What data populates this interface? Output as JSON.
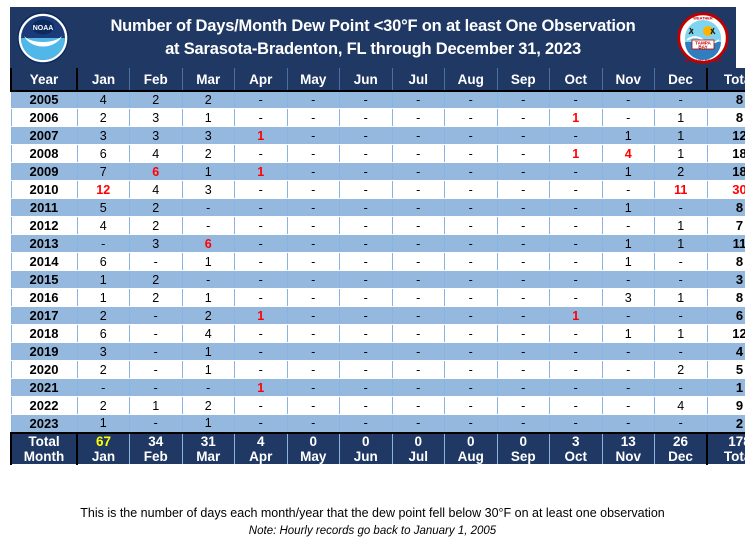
{
  "banner": {
    "title_line1": "Number of Days/Month Dew Point <30°F on at least One Observation",
    "title_line2": "at Sarasota-Bradenton, FL through December 31, 2023",
    "left_logo": "noaa-logo",
    "right_logo": "nws-tampa-bay-logo",
    "bg_color": "#1f3864"
  },
  "colors": {
    "header_bg": "#1f3864",
    "row_odd": "#95b8df",
    "row_even": "#ffffff",
    "highlight": "#ff0000",
    "total_highlight": "#ffff00",
    "grid_line": "#8ab3e0"
  },
  "table": {
    "columns": [
      "Year",
      "Jan",
      "Feb",
      "Mar",
      "Apr",
      "May",
      "Jun",
      "Jul",
      "Aug",
      "Sep",
      "Oct",
      "Nov",
      "Dec",
      "Total"
    ],
    "rows": [
      {
        "year": "2005",
        "values": [
          "4",
          "2",
          "2",
          "-",
          "-",
          "-",
          "-",
          "-",
          "-",
          "-",
          "-",
          "-"
        ],
        "hi": [],
        "total": "8",
        "total_hi": false
      },
      {
        "year": "2006",
        "values": [
          "2",
          "3",
          "1",
          "-",
          "-",
          "-",
          "-",
          "-",
          "-",
          "1",
          "-",
          "1"
        ],
        "hi": [
          9
        ],
        "total": "8",
        "total_hi": false
      },
      {
        "year": "2007",
        "values": [
          "3",
          "3",
          "3",
          "1",
          "-",
          "-",
          "-",
          "-",
          "-",
          "-",
          "1",
          "1"
        ],
        "hi": [
          3
        ],
        "total": "12",
        "total_hi": false
      },
      {
        "year": "2008",
        "values": [
          "6",
          "4",
          "2",
          "-",
          "-",
          "-",
          "-",
          "-",
          "-",
          "1",
          "4",
          "1"
        ],
        "hi": [
          9,
          10
        ],
        "total": "18",
        "total_hi": false
      },
      {
        "year": "2009",
        "values": [
          "7",
          "6",
          "1",
          "1",
          "-",
          "-",
          "-",
          "-",
          "-",
          "-",
          "1",
          "2"
        ],
        "hi": [
          1,
          3
        ],
        "total": "18",
        "total_hi": false
      },
      {
        "year": "2010",
        "values": [
          "12",
          "4",
          "3",
          "-",
          "-",
          "-",
          "-",
          "-",
          "-",
          "-",
          "-",
          "11"
        ],
        "hi": [
          0,
          11
        ],
        "total": "30",
        "total_hi": true
      },
      {
        "year": "2011",
        "values": [
          "5",
          "2",
          "-",
          "-",
          "-",
          "-",
          "-",
          "-",
          "-",
          "-",
          "1",
          "-"
        ],
        "hi": [],
        "total": "8",
        "total_hi": false
      },
      {
        "year": "2012",
        "values": [
          "4",
          "2",
          "-",
          "-",
          "-",
          "-",
          "-",
          "-",
          "-",
          "-",
          "-",
          "1"
        ],
        "hi": [],
        "total": "7",
        "total_hi": false
      },
      {
        "year": "2013",
        "values": [
          "-",
          "3",
          "6",
          "-",
          "-",
          "-",
          "-",
          "-",
          "-",
          "-",
          "1",
          "1"
        ],
        "hi": [
          2
        ],
        "total": "11",
        "total_hi": false
      },
      {
        "year": "2014",
        "values": [
          "6",
          "-",
          "1",
          "-",
          "-",
          "-",
          "-",
          "-",
          "-",
          "-",
          "1",
          "-"
        ],
        "hi": [],
        "total": "8",
        "total_hi": false
      },
      {
        "year": "2015",
        "values": [
          "1",
          "2",
          "-",
          "-",
          "-",
          "-",
          "-",
          "-",
          "-",
          "-",
          "-",
          "-"
        ],
        "hi": [],
        "total": "3",
        "total_hi": false
      },
      {
        "year": "2016",
        "values": [
          "1",
          "2",
          "1",
          "-",
          "-",
          "-",
          "-",
          "-",
          "-",
          "-",
          "3",
          "1"
        ],
        "hi": [],
        "total": "8",
        "total_hi": false
      },
      {
        "year": "2017",
        "values": [
          "2",
          "-",
          "2",
          "1",
          "-",
          "-",
          "-",
          "-",
          "-",
          "1",
          "-",
          "-"
        ],
        "hi": [
          3,
          9
        ],
        "total": "6",
        "total_hi": false
      },
      {
        "year": "2018",
        "values": [
          "6",
          "-",
          "4",
          "-",
          "-",
          "-",
          "-",
          "-",
          "-",
          "-",
          "1",
          "1"
        ],
        "hi": [],
        "total": "12",
        "total_hi": false
      },
      {
        "year": "2019",
        "values": [
          "3",
          "-",
          "1",
          "-",
          "-",
          "-",
          "-",
          "-",
          "-",
          "-",
          "-",
          "-"
        ],
        "hi": [],
        "total": "4",
        "total_hi": false
      },
      {
        "year": "2020",
        "values": [
          "2",
          "-",
          "1",
          "-",
          "-",
          "-",
          "-",
          "-",
          "-",
          "-",
          "-",
          "2"
        ],
        "hi": [],
        "total": "5",
        "total_hi": false
      },
      {
        "year": "2021",
        "values": [
          "-",
          "-",
          "-",
          "1",
          "-",
          "-",
          "-",
          "-",
          "-",
          "-",
          "-",
          "-"
        ],
        "hi": [
          3
        ],
        "total": "1",
        "total_hi": false
      },
      {
        "year": "2022",
        "values": [
          "2",
          "1",
          "2",
          "-",
          "-",
          "-",
          "-",
          "-",
          "-",
          "-",
          "-",
          "4"
        ],
        "hi": [],
        "total": "9",
        "total_hi": false
      },
      {
        "year": "2023",
        "values": [
          "1",
          "-",
          "1",
          "-",
          "-",
          "-",
          "-",
          "-",
          "-",
          "-",
          "-",
          "-"
        ],
        "hi": [],
        "total": "2",
        "total_hi": false
      }
    ],
    "footer": {
      "label_line1": "Total",
      "label_line2": "Month",
      "totals": [
        "67",
        "34",
        "31",
        "4",
        "0",
        "0",
        "0",
        "0",
        "0",
        "3",
        "13",
        "26"
      ],
      "month_labels": [
        "Jan",
        "Feb",
        "Mar",
        "Apr",
        "May",
        "Jun",
        "Jul",
        "Aug",
        "Sep",
        "Oct",
        "Nov",
        "Dec"
      ],
      "highlight_index": 0,
      "grand_total": "178",
      "grand_total_label": "Total"
    }
  },
  "notes": {
    "main": "This is the number of days each month/year that the dew point fell below 30°F on at least one observation",
    "sub": "Note: Hourly records go back to January 1, 2005"
  },
  "chart_data": {
    "type": "table",
    "title": "Number of Days/Month Dew Point <30°F on at least One Observation at Sarasota-Bradenton, FL through December 31, 2023",
    "categories": [
      "Jan",
      "Feb",
      "Mar",
      "Apr",
      "May",
      "Jun",
      "Jul",
      "Aug",
      "Sep",
      "Oct",
      "Nov",
      "Dec"
    ],
    "series": [
      {
        "name": "2005",
        "values": [
          4,
          2,
          2,
          0,
          0,
          0,
          0,
          0,
          0,
          0,
          0,
          0
        ],
        "total": 8
      },
      {
        "name": "2006",
        "values": [
          2,
          3,
          1,
          0,
          0,
          0,
          0,
          0,
          0,
          1,
          0,
          1
        ],
        "total": 8
      },
      {
        "name": "2007",
        "values": [
          3,
          3,
          3,
          1,
          0,
          0,
          0,
          0,
          0,
          0,
          1,
          1
        ],
        "total": 12
      },
      {
        "name": "2008",
        "values": [
          6,
          4,
          2,
          0,
          0,
          0,
          0,
          0,
          0,
          1,
          4,
          1
        ],
        "total": 18
      },
      {
        "name": "2009",
        "values": [
          7,
          6,
          1,
          1,
          0,
          0,
          0,
          0,
          0,
          0,
          1,
          2
        ],
        "total": 18
      },
      {
        "name": "2010",
        "values": [
          12,
          4,
          3,
          0,
          0,
          0,
          0,
          0,
          0,
          0,
          0,
          11
        ],
        "total": 30
      },
      {
        "name": "2011",
        "values": [
          5,
          2,
          0,
          0,
          0,
          0,
          0,
          0,
          0,
          0,
          1,
          0
        ],
        "total": 8
      },
      {
        "name": "2012",
        "values": [
          4,
          2,
          0,
          0,
          0,
          0,
          0,
          0,
          0,
          0,
          0,
          1
        ],
        "total": 7
      },
      {
        "name": "2013",
        "values": [
          0,
          3,
          6,
          0,
          0,
          0,
          0,
          0,
          0,
          0,
          1,
          1
        ],
        "total": 11
      },
      {
        "name": "2014",
        "values": [
          6,
          0,
          1,
          0,
          0,
          0,
          0,
          0,
          0,
          0,
          1,
          0
        ],
        "total": 8
      },
      {
        "name": "2015",
        "values": [
          1,
          2,
          0,
          0,
          0,
          0,
          0,
          0,
          0,
          0,
          0,
          0
        ],
        "total": 3
      },
      {
        "name": "2016",
        "values": [
          1,
          2,
          1,
          0,
          0,
          0,
          0,
          0,
          0,
          0,
          3,
          1
        ],
        "total": 8
      },
      {
        "name": "2017",
        "values": [
          2,
          0,
          2,
          1,
          0,
          0,
          0,
          0,
          0,
          1,
          0,
          0
        ],
        "total": 6
      },
      {
        "name": "2018",
        "values": [
          6,
          0,
          4,
          0,
          0,
          0,
          0,
          0,
          0,
          0,
          1,
          1
        ],
        "total": 12
      },
      {
        "name": "2019",
        "values": [
          3,
          0,
          1,
          0,
          0,
          0,
          0,
          0,
          0,
          0,
          0,
          0
        ],
        "total": 4
      },
      {
        "name": "2020",
        "values": [
          2,
          0,
          1,
          0,
          0,
          0,
          0,
          0,
          0,
          0,
          0,
          2
        ],
        "total": 5
      },
      {
        "name": "2021",
        "values": [
          0,
          0,
          0,
          1,
          0,
          0,
          0,
          0,
          0,
          0,
          0,
          0
        ],
        "total": 1
      },
      {
        "name": "2022",
        "values": [
          2,
          1,
          2,
          0,
          0,
          0,
          0,
          0,
          0,
          0,
          0,
          4
        ],
        "total": 9
      },
      {
        "name": "2023",
        "values": [
          1,
          0,
          1,
          0,
          0,
          0,
          0,
          0,
          0,
          0,
          0,
          0
        ],
        "total": 2
      }
    ],
    "column_totals": [
      67,
      34,
      31,
      4,
      0,
      0,
      0,
      0,
      0,
      3,
      13,
      26
    ],
    "grand_total": 178,
    "xlabel": "Month",
    "ylabel": "Year",
    "annotations": [
      "This is the number of days each month/year that the dew point fell below 30°F on at least one observation",
      "Note: Hourly records go back to January 1, 2005"
    ]
  }
}
